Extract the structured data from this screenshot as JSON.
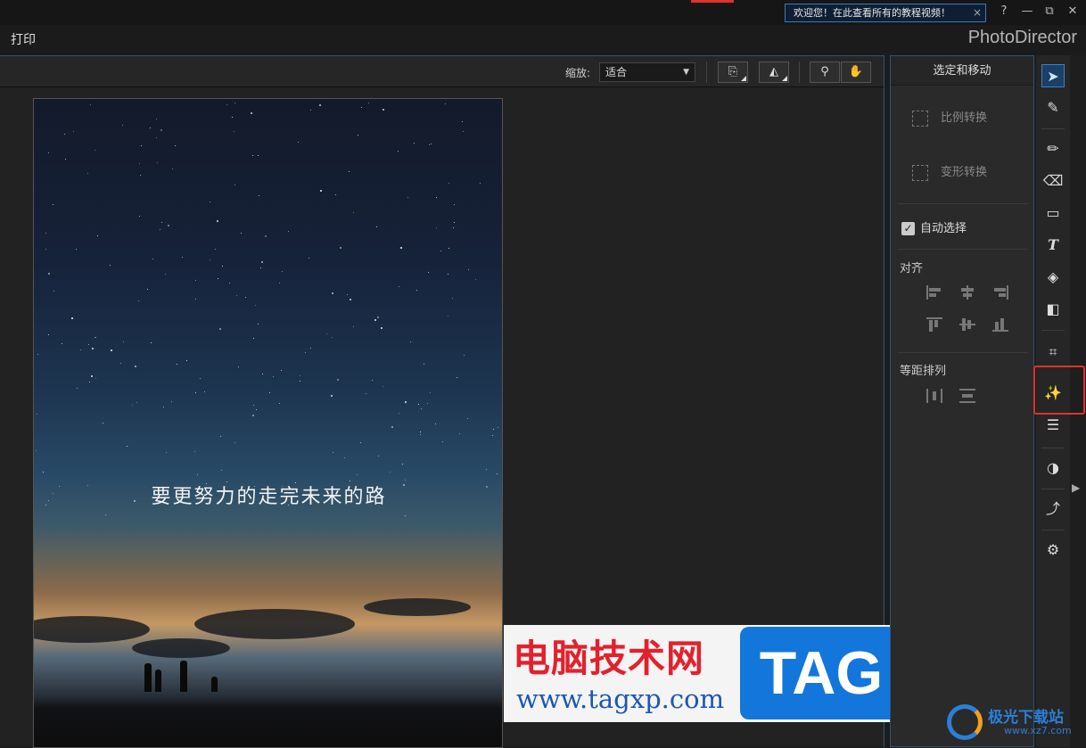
{
  "titlebar": {
    "welcome_text": "欢迎您！在此查看所有的教程视频！",
    "welcome_close": "×",
    "help": "?",
    "minimize": "—",
    "restore": "⧉",
    "close": "✕"
  },
  "menubar": {
    "print_label": "打印",
    "brand": "PhotoDirector"
  },
  "toolbar": {
    "zoom_label": "缩放:",
    "zoom_value": "适合",
    "zoom_icon": "magnifier-icon",
    "hand_icon": "hand-icon"
  },
  "photo": {
    "caption": "要更努力的走完未来的路"
  },
  "watermark": {
    "cn_text": "电脑技术网",
    "url": "www.tagxp.com",
    "tag": "TAG"
  },
  "panel": {
    "title": "选定和移动",
    "scale_transform": "比例转换",
    "warp_transform": "变形转换",
    "auto_select": "自动选择",
    "auto_select_checked": true,
    "align_label": "对齐",
    "distribute_label": "等距排列"
  },
  "tools": [
    {
      "name": "select-move-tool",
      "icon": "arrow-cursor-icon"
    },
    {
      "name": "brush-adjust-tool",
      "icon": "brush-icon"
    },
    {
      "name": "pencil-tool",
      "icon": "pencil-icon"
    },
    {
      "name": "eraser-tool",
      "icon": "eraser-icon"
    },
    {
      "name": "rectangle-tool",
      "icon": "rectangle-icon"
    },
    {
      "name": "text-tool",
      "icon": "text-icon"
    },
    {
      "name": "fill-tool",
      "icon": "paint-bucket-icon"
    },
    {
      "name": "gradient-tool",
      "icon": "gradient-icon"
    },
    {
      "name": "crop-tool",
      "icon": "crop-icon"
    },
    {
      "name": "magic-wand-tool",
      "icon": "magic-wand-icon"
    },
    {
      "name": "adjustments-tool",
      "icon": "sliders-icon"
    },
    {
      "name": "color-tool",
      "icon": "circle-half-icon"
    },
    {
      "name": "transform-tool",
      "icon": "rotate-arrow-icon"
    },
    {
      "name": "settings-tool",
      "icon": "gear-icon"
    }
  ],
  "corner_logo": {
    "text": "极光下载站",
    "url": "www.xz7.com"
  },
  "colors": {
    "accent": "#2e5476",
    "highlight_red": "#e0312b",
    "watermark_red": "#e3212d",
    "watermark_blue": "#1376db"
  }
}
